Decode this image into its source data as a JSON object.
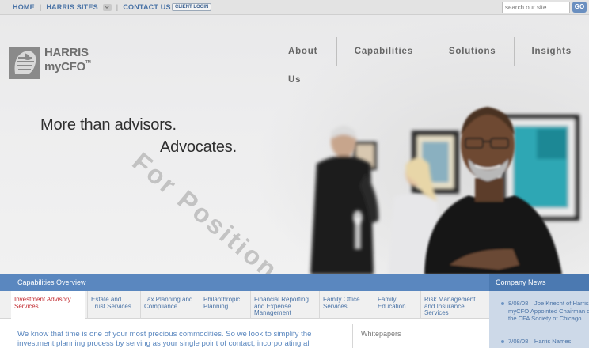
{
  "topbar": {
    "links": [
      "HOME",
      "HARRIS SITES",
      "CONTACT US"
    ],
    "client_login": "CLIENT LOGIN",
    "search_placeholder": "search our site",
    "go_label": "GO"
  },
  "logo": {
    "line1": "HARRIS",
    "line2": "myCFO",
    "tm": "TM"
  },
  "nav": [
    "About Us",
    "Capabilities",
    "Solutions",
    "Insights"
  ],
  "hero": {
    "tagline_1": "More than advisors.",
    "tagline_2": "Advocates.",
    "watermark": "For Position Only"
  },
  "capabilities": {
    "title": "Capabilities Overview",
    "tabs": [
      "Investment Advisory Services",
      "Estate and Trust Services",
      "Tax Planning and Compliance",
      "Philanthropic Planning",
      "Financial Reporting and Expense Management",
      "Family Office Services",
      "Family Education",
      "Risk Management and Insurance Services"
    ],
    "body": "We know that time is one of your most precious commodities. So we look to simplify the investment planning process by serving as your single point of contact, incorporating all",
    "whitepapers": "Whitepapers"
  },
  "news": {
    "title": "Company News",
    "items": [
      "8/08/08—Joe Knecht of Harris myCFO Appointed Chairman of the CFA Society of Chicago",
      "7/08/08—Harris Names"
    ]
  },
  "colors": {
    "link_blue": "#4a73a6",
    "bar_blue": "#5a87bf",
    "active_red": "#c0272d",
    "news_bg": "#cdd9e8"
  }
}
